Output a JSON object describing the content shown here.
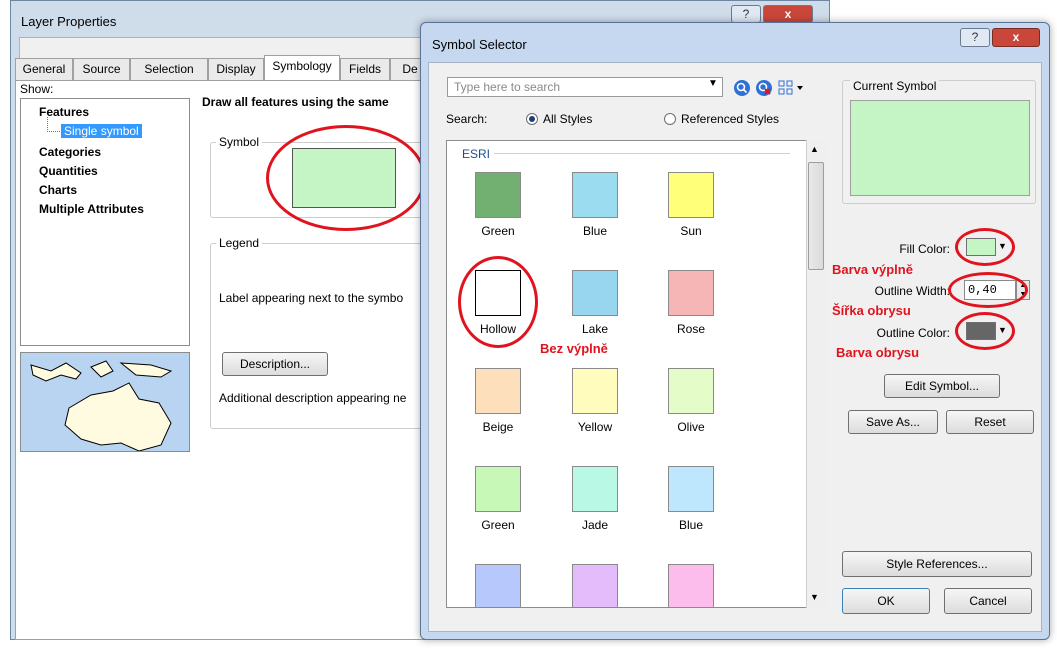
{
  "layer_properties": {
    "title": "Layer Properties",
    "help_label": "?",
    "close_label": "x",
    "tabs": [
      "General",
      "Source",
      "Selection",
      "Display",
      "Symbology",
      "Fields",
      "De"
    ],
    "show_label": "Show:",
    "show_list": {
      "features": "Features",
      "single_symbol": "Single symbol",
      "categories": "Categories",
      "quantities": "Quantities",
      "charts": "Charts",
      "multiple_attributes": "Multiple Attributes"
    },
    "draw_all": "Draw all features using the same",
    "symbol_group": "Symbol",
    "legend_group": "Legend",
    "legend_label_text": "Label appearing next to the symbo",
    "description_button": "Description...",
    "additional_description": "Additional description appearing ne",
    "symbol_fill": "#c5f5c5"
  },
  "symbol_selector": {
    "title": "Symbol Selector",
    "help_label": "?",
    "close_label": "x",
    "search_placeholder": "Type here to search",
    "search_label": "Search:",
    "all_styles": "All Styles",
    "referenced_styles": "Referenced Styles",
    "style_group": "ESRI",
    "symbols": [
      {
        "name": "Green",
        "color": "#72b072"
      },
      {
        "name": "Blue",
        "color": "#9cdcf0"
      },
      {
        "name": "Sun",
        "color": "#ffff7a"
      },
      {
        "name": "Hollow",
        "color": "#ffffff"
      },
      {
        "name": "Lake",
        "color": "#98d6f0"
      },
      {
        "name": "Rose",
        "color": "#f6b6b6"
      },
      {
        "name": "Beige",
        "color": "#fde0bb"
      },
      {
        "name": "Yellow",
        "color": "#fffcbe"
      },
      {
        "name": "Olive",
        "color": "#e4fcc8"
      },
      {
        "name": "Green",
        "color": "#c8f8b8"
      },
      {
        "name": "Jade",
        "color": "#b8f8e4"
      },
      {
        "name": "Blue",
        "color": "#bee6fc"
      },
      {
        "name": "",
        "color": "#b6c8fc"
      },
      {
        "name": "",
        "color": "#e4bcfc"
      },
      {
        "name": "",
        "color": "#fcbcec"
      }
    ],
    "current_symbol_label": "Current Symbol",
    "current_symbol_color": "#c5f5c5",
    "fill_color_label": "Fill Color:",
    "fill_color": "#c5f5c5",
    "outline_width_label": "Outline Width:",
    "outline_width_value": "0,40",
    "outline_color_label": "Outline Color:",
    "outline_color": "#666666",
    "edit_symbol_button": "Edit Symbol...",
    "save_as_button": "Save As...",
    "reset_button": "Reset",
    "style_references_button": "Style References...",
    "ok_button": "OK",
    "cancel_button": "Cancel"
  },
  "annotations": {
    "fill_color_cz": "Barva výplně",
    "outline_width_cz": "Šířka obrysu",
    "outline_color_cz": "Barva obrysu",
    "hollow_cz": "Bez výplně"
  }
}
